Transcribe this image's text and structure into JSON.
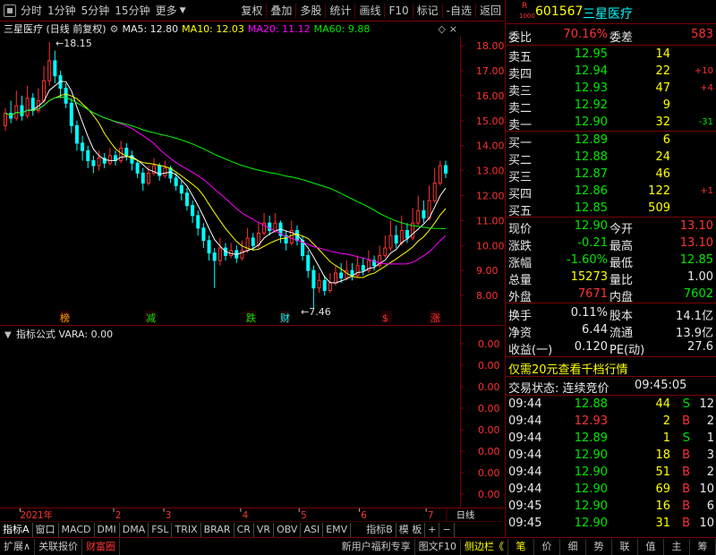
{
  "toolbar": {
    "left": [
      "分时",
      "1分钟",
      "5分钟",
      "15分钟",
      "更多"
    ],
    "right": [
      "复权",
      "叠加",
      "多股",
      "统计",
      "画线",
      "F10",
      "标记",
      "-自选",
      "返回"
    ]
  },
  "chart_head": {
    "title": "三星医疗 (日线 前复权)",
    "ma5": "MA5: 12.80",
    "ma10": "MA10: 12.03",
    "ma20": "MA20: 11.12",
    "ma60": "MA60: 9.88"
  },
  "colors": {
    "ma5": "#ffffff",
    "ma10": "#ffff00",
    "ma20": "#ff00ff",
    "ma60": "#00ff00",
    "up": "#ff3232",
    "down": "#00ffff",
    "border": "#7a0000"
  },
  "chart_data": {
    "type": "candlestick",
    "ylim": [
      7.5,
      18.4
    ],
    "yticks": [
      "18.00",
      "17.00",
      "16.00",
      "15.00",
      "14.00",
      "13.00",
      "12.00",
      "11.00",
      "10.00",
      "9.00",
      "8.00"
    ],
    "high_label": "18.15",
    "low_label": "7.46",
    "events": [
      "榜",
      "减",
      "跌",
      "财",
      "$",
      "涨"
    ],
    "months": [
      "2021年",
      "2",
      "3",
      "4",
      "5",
      "6",
      "7"
    ],
    "candles": [
      [
        14.8,
        15.3,
        15.5,
        14.6
      ],
      [
        15.3,
        15.1,
        15.8,
        14.9
      ],
      [
        15.1,
        15.6,
        16.2,
        15.0
      ],
      [
        15.6,
        15.2,
        16.0,
        15.0
      ],
      [
        15.2,
        15.9,
        16.4,
        15.1
      ],
      [
        15.9,
        15.4,
        16.1,
        15.2
      ],
      [
        15.4,
        15.8,
        16.3,
        15.3
      ],
      [
        15.8,
        16.6,
        17.2,
        15.7
      ],
      [
        16.6,
        17.4,
        18.15,
        16.4
      ],
      [
        17.4,
        16.8,
        17.8,
        16.5
      ],
      [
        16.8,
        16.3,
        17.0,
        15.9
      ],
      [
        16.3,
        15.7,
        16.5,
        15.5
      ],
      [
        15.7,
        14.8,
        15.9,
        14.5
      ],
      [
        14.8,
        14.1,
        15.0,
        13.8
      ],
      [
        14.1,
        13.8,
        14.4,
        13.4
      ],
      [
        13.8,
        13.4,
        14.0,
        13.1
      ],
      [
        13.4,
        13.2,
        13.6,
        12.9
      ],
      [
        13.2,
        13.5,
        13.8,
        13.0
      ],
      [
        13.5,
        13.3,
        13.7,
        13.1
      ],
      [
        13.3,
        13.6,
        13.9,
        13.2
      ],
      [
        13.6,
        13.4,
        13.8,
        13.2
      ],
      [
        13.4,
        13.9,
        14.2,
        13.3
      ],
      [
        13.9,
        13.6,
        14.1,
        13.4
      ],
      [
        13.6,
        13.3,
        13.8,
        13.0
      ],
      [
        13.3,
        12.9,
        13.4,
        12.7
      ],
      [
        12.9,
        12.5,
        13.1,
        12.2
      ],
      [
        12.5,
        12.9,
        13.2,
        12.4
      ],
      [
        12.9,
        13.2,
        13.5,
        12.8
      ],
      [
        13.2,
        12.8,
        13.3,
        12.6
      ],
      [
        12.8,
        13.1,
        13.4,
        12.7
      ],
      [
        13.1,
        12.7,
        13.2,
        12.5
      ],
      [
        12.7,
        12.4,
        12.9,
        12.2
      ],
      [
        12.4,
        12.1,
        12.6,
        11.8
      ],
      [
        12.1,
        11.6,
        12.3,
        11.4
      ],
      [
        11.6,
        11.2,
        11.8,
        10.9
      ],
      [
        11.2,
        10.7,
        11.4,
        10.4
      ],
      [
        10.7,
        10.2,
        10.9,
        9.9
      ],
      [
        10.2,
        9.7,
        10.4,
        9.4
      ],
      [
        9.7,
        9.4,
        9.9,
        8.3
      ],
      [
        9.4,
        9.9,
        10.3,
        9.2
      ],
      [
        9.9,
        9.6,
        10.1,
        9.4
      ],
      [
        9.6,
        9.8,
        10.1,
        9.5
      ],
      [
        9.8,
        9.5,
        10.0,
        9.3
      ],
      [
        9.5,
        9.8,
        10.2,
        9.4
      ],
      [
        9.8,
        10.3,
        10.7,
        9.7
      ],
      [
        10.3,
        10.0,
        10.5,
        9.8
      ],
      [
        10.0,
        10.5,
        10.9,
        9.9
      ],
      [
        10.5,
        10.9,
        11.3,
        10.4
      ],
      [
        10.9,
        10.6,
        11.2,
        10.4
      ],
      [
        10.6,
        10.9,
        11.3,
        10.5
      ],
      [
        10.9,
        10.4,
        11.0,
        10.1
      ],
      [
        10.4,
        10.1,
        10.6,
        9.8
      ],
      [
        10.1,
        10.6,
        11.0,
        10.0
      ],
      [
        10.6,
        10.2,
        10.8,
        10.0
      ],
      [
        10.2,
        9.6,
        10.4,
        9.4
      ],
      [
        9.6,
        9.0,
        9.8,
        8.7
      ],
      [
        9.0,
        8.3,
        9.2,
        7.46
      ],
      [
        8.3,
        8.6,
        8.9,
        8.1
      ],
      [
        8.6,
        8.2,
        8.8,
        8.0
      ],
      [
        8.2,
        8.5,
        8.9,
        8.1
      ],
      [
        8.5,
        8.9,
        9.2,
        8.4
      ],
      [
        8.9,
        8.7,
        9.3,
        8.5
      ],
      [
        8.7,
        9.0,
        9.4,
        8.6
      ],
      [
        9.0,
        8.8,
        9.3,
        8.6
      ],
      [
        8.8,
        9.2,
        9.6,
        8.7
      ],
      [
        9.2,
        9.0,
        9.5,
        8.8
      ],
      [
        9.0,
        9.4,
        9.8,
        8.9
      ],
      [
        9.4,
        9.2,
        9.6,
        9.0
      ],
      [
        9.2,
        9.6,
        10.0,
        9.1
      ],
      [
        9.6,
        9.9,
        10.4,
        9.5
      ],
      [
        9.9,
        10.4,
        11.0,
        9.8
      ],
      [
        10.4,
        10.1,
        10.8,
        9.9
      ],
      [
        10.1,
        10.6,
        11.2,
        10.0
      ],
      [
        10.6,
        10.3,
        10.9,
        10.1
      ],
      [
        10.3,
        10.9,
        11.5,
        10.2
      ],
      [
        10.9,
        11.4,
        12.0,
        10.8
      ],
      [
        11.4,
        11.1,
        11.8,
        10.9
      ],
      [
        11.1,
        11.8,
        12.4,
        11.0
      ],
      [
        11.8,
        12.5,
        13.1,
        11.7
      ],
      [
        12.5,
        13.2,
        13.4,
        12.4
      ],
      [
        13.2,
        12.9,
        13.4,
        12.7
      ]
    ]
  },
  "indicator": {
    "title": "指标公式 VARA: 0.00",
    "yticks": [
      "0.00",
      "0.00",
      "0.00",
      "0.00",
      "0.00",
      "0.00",
      "0.00",
      "0.00"
    ]
  },
  "tabs": [
    "指标A",
    "窗口",
    "MACD",
    "DMI",
    "DMA",
    "FSL",
    "TRIX",
    "BRAR",
    "CR",
    "VR",
    "OBV",
    "ASI",
    "EMV",
    "指标B",
    "模 板",
    "+",
    "−"
  ],
  "axis_right_label": "日线",
  "footer": {
    "left": [
      "扩展∧",
      "关联报价",
      "财富圈"
    ],
    "right": [
      "新用户福利专享",
      "图文F10",
      "侧边栏《"
    ],
    "panel_tabs": [
      "笔",
      "价",
      "细",
      "势",
      "联",
      "值",
      "主",
      "筹"
    ]
  },
  "quote": {
    "code_prefix": "R",
    "code_sub": "1000",
    "code": "601567",
    "name": "三星医疗",
    "weibi_label": "委比",
    "weibi": "70.16%",
    "weicha_label": "委差",
    "weicha": "583",
    "asks": [
      {
        "label": "卖五",
        "price": "12.95",
        "vol": "14",
        "chg": ""
      },
      {
        "label": "卖四",
        "price": "12.94",
        "vol": "22",
        "chg": "+10"
      },
      {
        "label": "卖三",
        "price": "12.93",
        "vol": "47",
        "chg": "+4"
      },
      {
        "label": "卖二",
        "price": "12.92",
        "vol": "9",
        "chg": ""
      },
      {
        "label": "卖一",
        "price": "12.90",
        "vol": "32",
        "chg": "-31"
      }
    ],
    "bids": [
      {
        "label": "买一",
        "price": "12.89",
        "vol": "6",
        "chg": ""
      },
      {
        "label": "买二",
        "price": "12.88",
        "vol": "24",
        "chg": ""
      },
      {
        "label": "买三",
        "price": "12.87",
        "vol": "46",
        "chg": ""
      },
      {
        "label": "买四",
        "price": "12.86",
        "vol": "122",
        "chg": "+1"
      },
      {
        "label": "买五",
        "price": "12.85",
        "vol": "509",
        "chg": ""
      }
    ],
    "stats": [
      {
        "l1": "现价",
        "v1": "12.90",
        "c1": "green",
        "l2": "今开",
        "v2": "13.10",
        "c2": "red"
      },
      {
        "l1": "涨跌",
        "v1": "-0.21",
        "c1": "green",
        "l2": "最高",
        "v2": "13.10",
        "c2": "red"
      },
      {
        "l1": "涨幅",
        "v1": "-1.60%",
        "c1": "green",
        "l2": "最低",
        "v2": "12.85",
        "c2": "green"
      },
      {
        "l1": "总量",
        "v1": "15273",
        "c1": "yellow",
        "l2": "量比",
        "v2": "1.00",
        "c2": "white"
      },
      {
        "l1": "外盘",
        "v1": "7671",
        "c1": "red",
        "l2": "内盘",
        "v2": "7602",
        "c2": "green"
      }
    ],
    "stats2": [
      {
        "l1": "换手",
        "v1": "0.11%",
        "l2": "股本",
        "v2": "14.1亿"
      },
      {
        "l1": "净资",
        "v1": "6.44",
        "l2": "流通",
        "v2": "13.9亿"
      },
      {
        "l1": "收益(一)",
        "v1": "0.120",
        "l2": "PE(动)",
        "v2": "27.6"
      }
    ],
    "promo": "仅需20元查看千档行情",
    "trade_status_label": "交易状态: 连续竞价",
    "trade_status_time": "09:45:05",
    "ticks": [
      {
        "t": "09:44",
        "p": "12.88",
        "v": "44",
        "s": "S",
        "n": "12"
      },
      {
        "t": "09:44",
        "p": "12.93",
        "v": "2",
        "s": "B",
        "n": "2"
      },
      {
        "t": "09:44",
        "p": "12.89",
        "v": "1",
        "s": "S",
        "n": "1"
      },
      {
        "t": "09:44",
        "p": "12.90",
        "v": "18",
        "s": "B",
        "n": "3"
      },
      {
        "t": "09:44",
        "p": "12.90",
        "v": "51",
        "s": "B",
        "n": "2"
      },
      {
        "t": "09:44",
        "p": "12.90",
        "v": "69",
        "s": "B",
        "n": "10"
      },
      {
        "t": "09:45",
        "p": "12.90",
        "v": "16",
        "s": "B",
        "n": "6"
      },
      {
        "t": "09:45",
        "p": "12.90",
        "v": "31",
        "s": "B",
        "n": "10"
      }
    ]
  }
}
